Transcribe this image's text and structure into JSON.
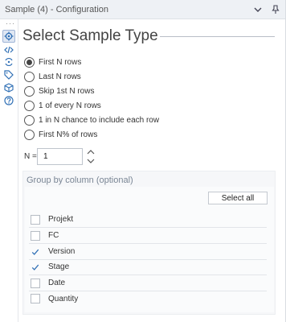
{
  "window": {
    "title": "Sample (4) - Configuration",
    "collapse_icon": "chevron-down-icon",
    "pin_icon": "pin-icon"
  },
  "sidebar": {
    "icons": [
      "gear-icon",
      "code-icon",
      "connection-icon",
      "tag-icon",
      "cube-icon",
      "help-icon"
    ]
  },
  "heading": "Select Sample Type",
  "sample_options": [
    {
      "label": "First N rows",
      "selected": true
    },
    {
      "label": "Last N rows",
      "selected": false
    },
    {
      "label": "Skip 1st N rows",
      "selected": false
    },
    {
      "label": "1 of every N rows",
      "selected": false
    },
    {
      "label": "1 in N chance to include each row",
      "selected": false
    },
    {
      "label": "First N% of rows",
      "selected": false
    }
  ],
  "n_field": {
    "label": "N =",
    "value": "1"
  },
  "group_by": {
    "title": "Group by column (optional)",
    "select_all_label": "Select all",
    "columns": [
      {
        "label": "Projekt",
        "checked": false
      },
      {
        "label": "FC",
        "checked": false
      },
      {
        "label": "Version",
        "checked": true
      },
      {
        "label": "Stage",
        "checked": true
      },
      {
        "label": "Date",
        "checked": false
      },
      {
        "label": "Quantity",
        "checked": false
      }
    ]
  },
  "colors": {
    "accent": "#2f6fb5",
    "titlebar_bg": "#eef1f5",
    "group_bg": "#f6f7f9"
  }
}
